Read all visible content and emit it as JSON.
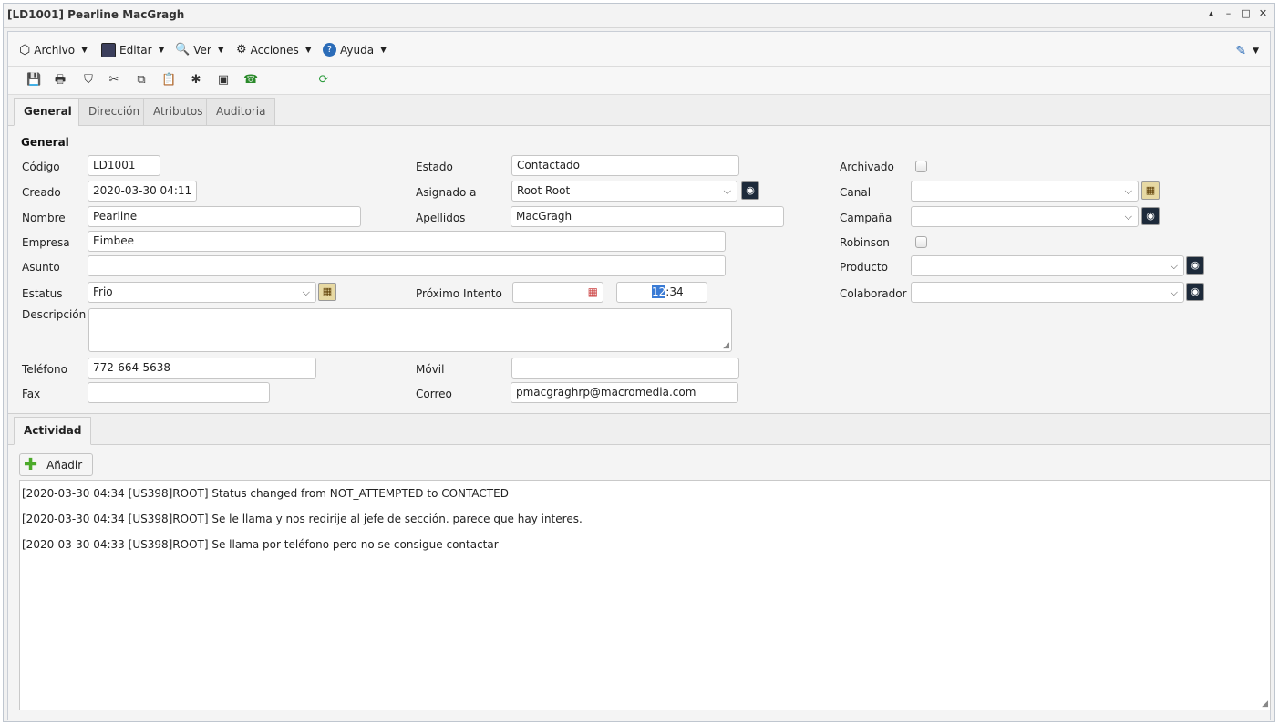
{
  "window": {
    "title": "[LD1001] Pearline MacGragh",
    "controls": [
      "▴",
      "–",
      "□",
      "✕"
    ]
  },
  "menu": {
    "items": [
      {
        "label": "Archivo",
        "icon": "archive-icon"
      },
      {
        "label": "Editar",
        "icon": "edit-icon"
      },
      {
        "label": "Ver",
        "icon": "view-icon"
      },
      {
        "label": "Acciones",
        "icon": "actions-icon"
      },
      {
        "label": "Ayuda",
        "icon": "help-icon"
      }
    ],
    "user_icon": "user-edit-icon"
  },
  "toolbar": {
    "tools": [
      "save-icon",
      "print-icon",
      "delete-icon",
      "cut-icon",
      "copy-icon",
      "paste-icon",
      "bug-icon",
      "image-icon",
      "phone-icon",
      "refresh-icon"
    ]
  },
  "tabs": [
    "General",
    "Dirección",
    "Atributos",
    "Auditoria"
  ],
  "form": {
    "section_title": "General",
    "codigo": {
      "label": "Código",
      "value": "LD1001"
    },
    "creado": {
      "label": "Creado",
      "value": "2020-03-30 04:11"
    },
    "nombre": {
      "label": "Nombre",
      "value": "Pearline"
    },
    "empresa": {
      "label": "Empresa",
      "value": "Eimbee"
    },
    "asunto": {
      "label": "Asunto",
      "value": ""
    },
    "estatus": {
      "label": "Estatus",
      "value": "Frio"
    },
    "descripcion": {
      "label": "Descripción",
      "value": ""
    },
    "telefono": {
      "label": "Teléfono",
      "value": "772-664-5638"
    },
    "fax": {
      "label": "Fax",
      "value": ""
    },
    "estado": {
      "label": "Estado",
      "value": "Contactado"
    },
    "asignado": {
      "label": "Asignado a",
      "value": "Root Root"
    },
    "apellidos": {
      "label": "Apellidos",
      "value": "MacGragh"
    },
    "proximo": {
      "label": "Próximo Intento",
      "date": "",
      "time_hour": "12",
      "time_rest": ":34"
    },
    "movil": {
      "label": "Móvil",
      "value": ""
    },
    "correo": {
      "label": "Correo",
      "value": "pmacgraghrp@macromedia.com"
    },
    "archivado": {
      "label": "Archivado",
      "checked": false
    },
    "canal": {
      "label": "Canal",
      "value": ""
    },
    "campana": {
      "label": "Campaña",
      "value": ""
    },
    "robinson": {
      "label": "Robinson",
      "checked": false
    },
    "producto": {
      "label": "Producto",
      "value": ""
    },
    "colaborador": {
      "label": "Colaborador",
      "value": ""
    }
  },
  "activity": {
    "tab": "Actividad",
    "add_label": "Añadir",
    "log": [
      "[2020-03-30 04:34 [US398]ROOT] Status changed from NOT_ATTEMPTED to CONTACTED",
      "[2020-03-30 04:34 [US398]ROOT] Se le llama y nos redirije al jefe de sección. parece que hay interes.",
      "[2020-03-30 04:33 [US398]ROOT] Se llama por teléfono pero no se consigue contactar"
    ]
  }
}
